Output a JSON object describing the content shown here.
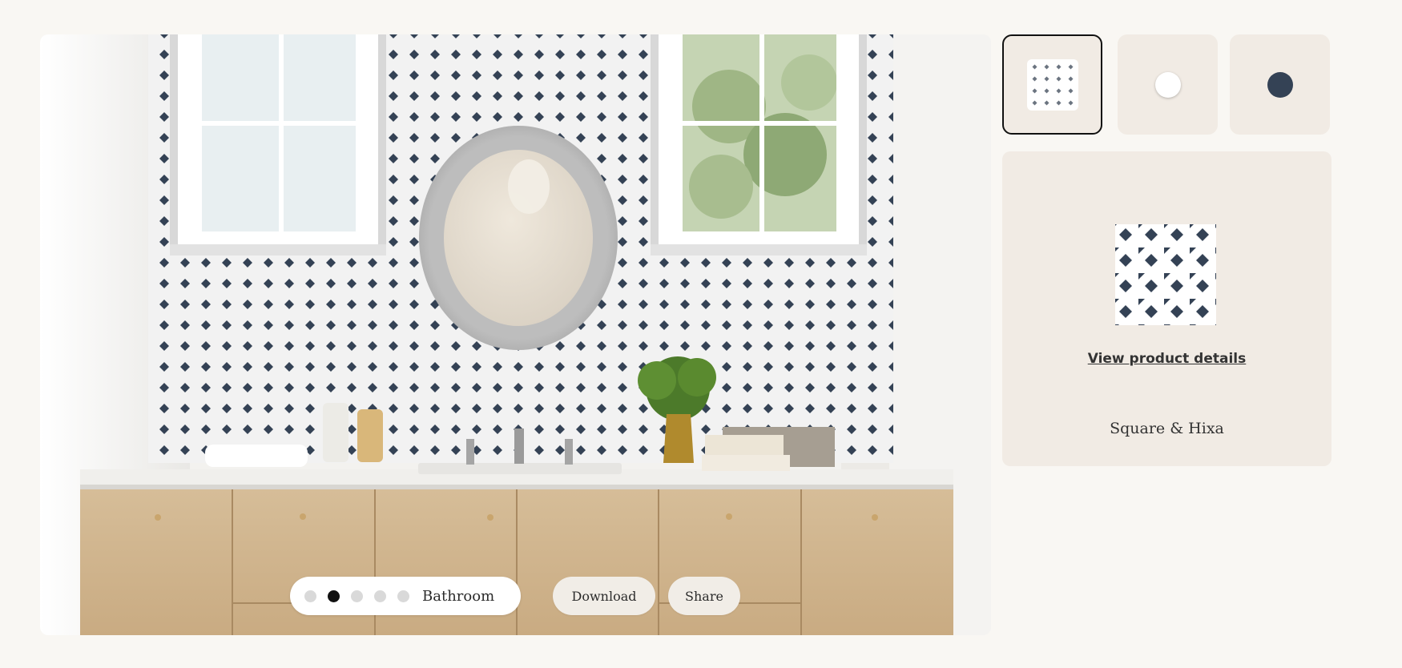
{
  "preview": {
    "room_dots": [
      {
        "active": false
      },
      {
        "active": true
      },
      {
        "active": false
      },
      {
        "active": false
      },
      {
        "active": false
      }
    ],
    "room_label": "Bathroom",
    "download_label": "Download",
    "share_label": "Share"
  },
  "swatches": [
    {
      "kind": "pattern",
      "selected": true
    },
    {
      "kind": "color",
      "color": "#ffffff",
      "selected": false
    },
    {
      "kind": "color",
      "color": "#344255",
      "selected": false
    }
  ],
  "product": {
    "link_label": "View product details",
    "name": "Square & Hixa"
  },
  "colors": {
    "page_bg": "#f9f7f3",
    "card_bg": "#f1ebe4",
    "tile_diamond": "#344255",
    "tile_bg": "#ffffff"
  }
}
